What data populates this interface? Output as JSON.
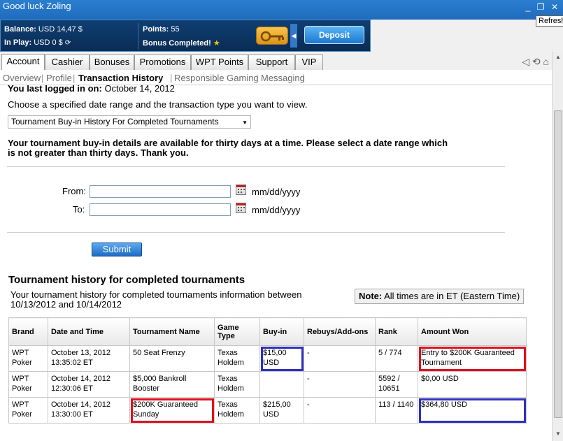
{
  "window": {
    "title": "Good luck Zoling"
  },
  "tooltip": {
    "refresh": "Refresh"
  },
  "account": {
    "balance_label": "Balance:",
    "balance_value": "USD 14,47 $",
    "inplay_label": "In Play:",
    "inplay_value": "USD 0 $",
    "points_label": "Points:",
    "points_value": "55",
    "bonus_text": "Bonus Completed!",
    "deposit_label": "Deposit"
  },
  "tabs": [
    "Account",
    "Cashier",
    "Bonuses",
    "Promotions",
    "WPT Points",
    "Support",
    "VIP"
  ],
  "subnav": [
    "Overview",
    "Profile",
    "Transaction History",
    "Responsible Gaming",
    "Messaging"
  ],
  "content": {
    "last_logged_label": "You last logged in on:",
    "last_logged_date": "October 14, 2012",
    "choose_text": "Choose a specified date range and the transaction type you want to view.",
    "select_value": "Tournament Buy-in History For Completed Tournaments",
    "notice_line1": "Your tournament buy-in details are available for thirty days at a time. Please select a date range which",
    "notice_line2": "is not greater than thirty days. Thank you.",
    "from_label": "From:",
    "to_label": "To:",
    "date_format": "mm/dd/yyyy",
    "submit_label": "Submit",
    "history_title": "Tournament history for completed tournaments",
    "history_desc1": "Your tournament history for completed tournaments information between",
    "history_desc2": "10/13/2012 and 10/14/2012",
    "note_label": "Note:",
    "note_text": "All times are in ET (Eastern Time)"
  },
  "table": {
    "headers": [
      "Brand",
      "Date and Time",
      "Tournament Name",
      "Game Type",
      "Buy-in",
      "Rebuys/Add-ons",
      "Rank",
      "Amount Won"
    ],
    "rows": [
      [
        "WPT Poker",
        "October 13, 2012 13:35:02 ET",
        "50 Seat Frenzy",
        "Texas Holdem",
        "$15,00 USD",
        "-",
        "5 / 774",
        "Entry to $200K Guaranteed Tournament"
      ],
      [
        "WPT Poker",
        "October 14, 2012 12:30:06 ET",
        "$5,000 Bankroll Booster",
        "Texas Holdem",
        "",
        "-",
        "5592 / 10651",
        "$0,00 USD"
      ],
      [
        "WPT Poker",
        "October 14, 2012 13:30:00 ET",
        "$200K Guaranteed Sunday",
        "Texas Holdem",
        "$215,00 USD",
        "-",
        "113 / 1140",
        "$364,80 USD"
      ]
    ]
  }
}
